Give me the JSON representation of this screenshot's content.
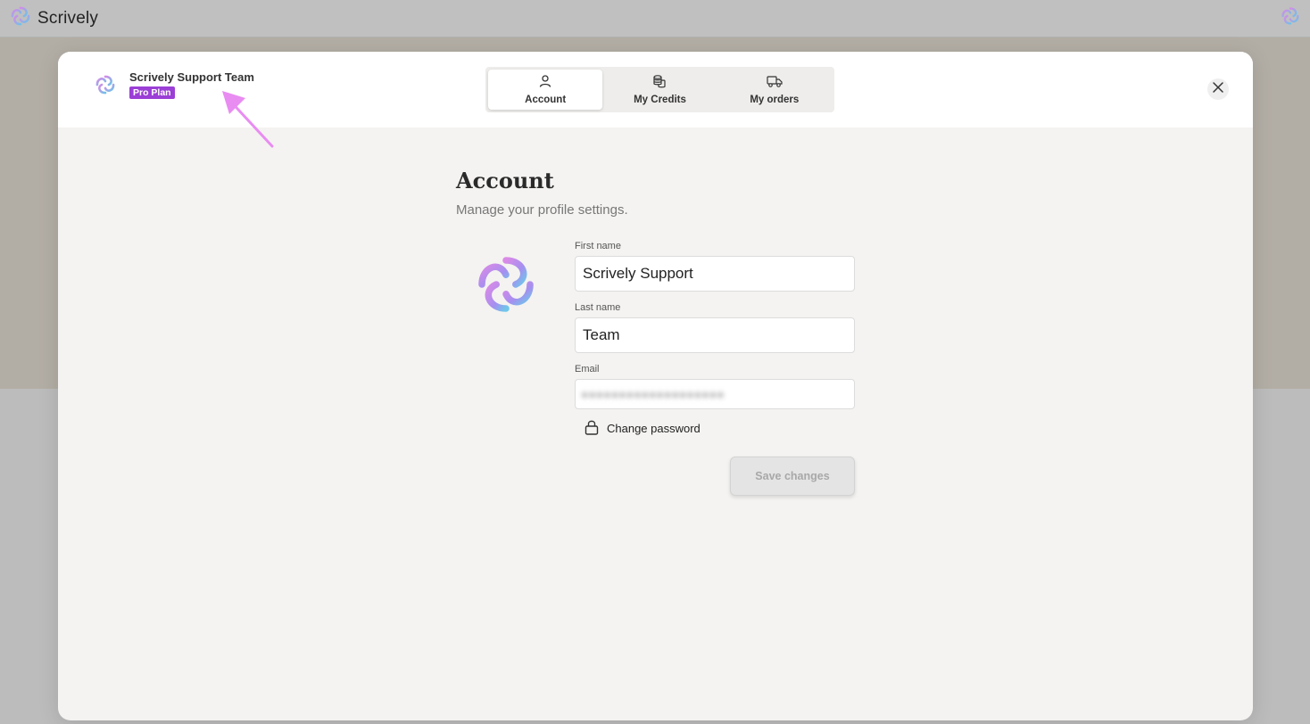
{
  "app": {
    "brand_name": "Scrively",
    "logo_icon": "scrively-swirl-icon"
  },
  "modal": {
    "user": {
      "name": "Scrively Support Team",
      "plan": "Pro Plan",
      "plan_color": "#9b3fd6"
    },
    "tabs": [
      {
        "label": "Account",
        "icon": "person-icon",
        "active": true
      },
      {
        "label": "My Credits",
        "icon": "coins-icon",
        "active": false
      },
      {
        "label": "My orders",
        "icon": "truck-icon",
        "active": false
      }
    ],
    "close_icon": "close-icon"
  },
  "account": {
    "title": "Account",
    "subtitle": "Manage your profile settings.",
    "first_name_label": "First name",
    "first_name_value": "Scrively Support",
    "last_name_label": "Last name",
    "last_name_value": "Team",
    "email_label": "Email",
    "change_password_label": "Change password",
    "save_label": "Save changes"
  },
  "colors": {
    "annotation_arrow": "#e98cf2",
    "accent_purple": "#9b3fd6"
  }
}
